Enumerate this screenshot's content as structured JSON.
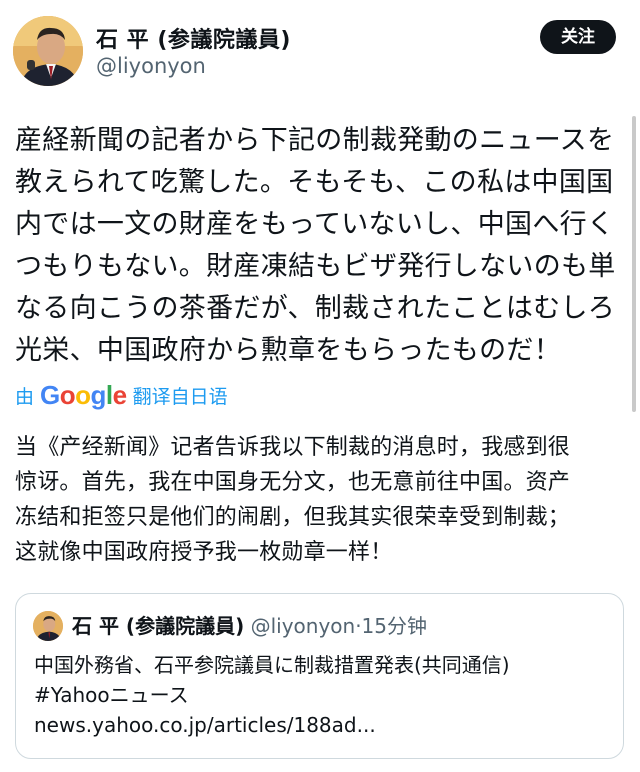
{
  "author": {
    "name": "石 平 (参議院議員)",
    "handle": "@liyonyon",
    "avatar_icon": "politician-portrait-avatar"
  },
  "follow_button": {
    "label": "关注"
  },
  "tweet": {
    "lines": [
      "産経新聞の記者から下記の制裁発動のニュースを",
      "教えられて吃驚した。そもそも、この私は中国国",
      "内では一文の財産をもっていないし、中国へ行く",
      "つもりもない。財産凍結もビザ発行しないのも単",
      "なる向こうの茶番だが、制裁されたことはむしろ",
      "光栄、中国政府から勲章をもらったものだ！"
    ]
  },
  "translation_bar": {
    "prefix": "由",
    "provider": "Google",
    "suffix": "翻译自日语"
  },
  "translation": {
    "lines": [
      "当《产经新闻》记者告诉我以下制裁的消息时，我感到很",
      "惊讶。首先，我在中国身无分文，也无意前往中国。资产",
      "冻结和拒签只是他们的闹剧，但我其实很荣幸受到制裁；",
      "这就像中国政府授予我一枚勋章一样！"
    ]
  },
  "quoted": {
    "name": "石 平 (参議院議員)",
    "handle": "@liyonyon",
    "separator": "·",
    "time": "15分钟",
    "lines": [
      "中国外務省、石平参院議員に制裁措置発表(共同通信)",
      "#Yahooニュース",
      "news.yahoo.co.jp/articles/188ad..."
    ]
  },
  "colors": {
    "link": "#1d9bf0",
    "text": "#0f1419",
    "muted": "#536471",
    "button_bg": "#0f1419",
    "google_blue": "#4285F4",
    "google_red": "#EA4335",
    "google_yellow": "#FBBC05",
    "google_green": "#34A853"
  }
}
